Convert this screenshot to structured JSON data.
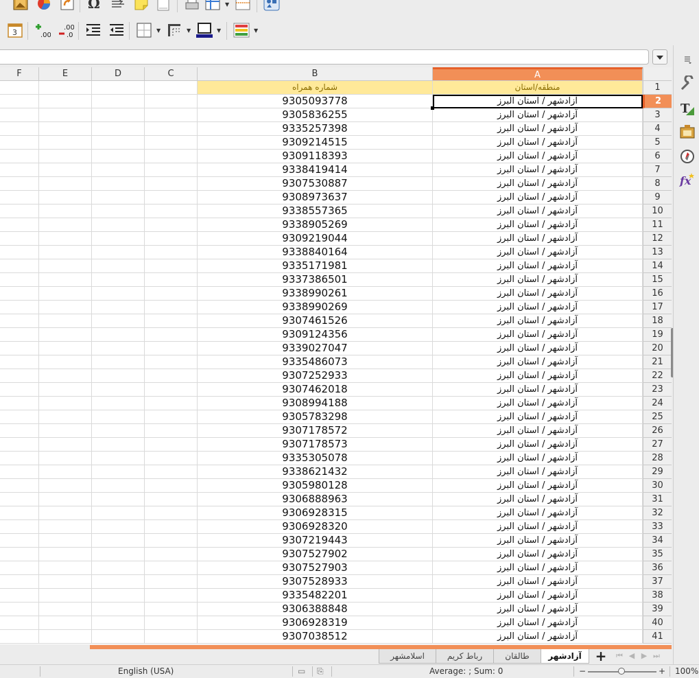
{
  "columns": {
    "f": "F",
    "e": "E",
    "d": "D",
    "c": "C",
    "b": "B",
    "a": "A"
  },
  "header_row": {
    "row": "1",
    "b": "شماره همراه",
    "a": "منطقه/استان"
  },
  "rows": [
    {
      "row": "2",
      "b": "9305093778",
      "a": "آزادشهر / استان البرز"
    },
    {
      "row": "3",
      "b": "9305836255",
      "a": "آزادشهر / استان البرز"
    },
    {
      "row": "4",
      "b": "9335257398",
      "a": "آزادشهر / استان البرز"
    },
    {
      "row": "5",
      "b": "9309214515",
      "a": "آزادشهر / استان البرز"
    },
    {
      "row": "6",
      "b": "9309118393",
      "a": "آزادشهر / استان البرز"
    },
    {
      "row": "7",
      "b": "9338419414",
      "a": "آزادشهر / استان البرز"
    },
    {
      "row": "8",
      "b": "9307530887",
      "a": "آزادشهر / استان البرز"
    },
    {
      "row": "9",
      "b": "9308973637",
      "a": "آزادشهر / استان البرز"
    },
    {
      "row": "10",
      "b": "9338557365",
      "a": "آزادشهر / استان البرز"
    },
    {
      "row": "11",
      "b": "9338905269",
      "a": "آزادشهر / استان البرز"
    },
    {
      "row": "12",
      "b": "9309219044",
      "a": "آزادشهر / استان البرز"
    },
    {
      "row": "13",
      "b": "9338840164",
      "a": "آزادشهر / استان البرز"
    },
    {
      "row": "14",
      "b": "9335171981",
      "a": "آزادشهر / استان البرز"
    },
    {
      "row": "15",
      "b": "9337386501",
      "a": "آزادشهر / استان البرز"
    },
    {
      "row": "16",
      "b": "9338990261",
      "a": "آزادشهر / استان البرز"
    },
    {
      "row": "17",
      "b": "9338990269",
      "a": "آزادشهر / استان البرز"
    },
    {
      "row": "18",
      "b": "9307461526",
      "a": "آزادشهر / استان البرز"
    },
    {
      "row": "19",
      "b": "9309124356",
      "a": "آزادشهر / استان البرز"
    },
    {
      "row": "20",
      "b": "9339027047",
      "a": "آزادشهر / استان البرز"
    },
    {
      "row": "21",
      "b": "9335486073",
      "a": "آزادشهر / استان البرز"
    },
    {
      "row": "22",
      "b": "9307252933",
      "a": "آزادشهر / استان البرز"
    },
    {
      "row": "23",
      "b": "9307462018",
      "a": "آزادشهر / استان البرز"
    },
    {
      "row": "24",
      "b": "9308994188",
      "a": "آزادشهر / استان البرز"
    },
    {
      "row": "25",
      "b": "9305783298",
      "a": "آزادشهر / استان البرز"
    },
    {
      "row": "26",
      "b": "9307178572",
      "a": "آزادشهر / استان البرز"
    },
    {
      "row": "27",
      "b": "9307178573",
      "a": "آزادشهر / استان البرز"
    },
    {
      "row": "28",
      "b": "9335305078",
      "a": "آزادشهر / استان البرز"
    },
    {
      "row": "29",
      "b": "9338621432",
      "a": "آزادشهر / استان البرز"
    },
    {
      "row": "30",
      "b": "9305980128",
      "a": "آزادشهر / استان البرز"
    },
    {
      "row": "31",
      "b": "9306888963",
      "a": "آزادشهر / استان البرز"
    },
    {
      "row": "32",
      "b": "9306928315",
      "a": "آزادشهر / استان البرز"
    },
    {
      "row": "33",
      "b": "9306928320",
      "a": "آزادشهر / استان البرز"
    },
    {
      "row": "34",
      "b": "9307219443",
      "a": "آزادشهر / استان البرز"
    },
    {
      "row": "35",
      "b": "9307527902",
      "a": "آزادشهر / استان البرز"
    },
    {
      "row": "36",
      "b": "9307527903",
      "a": "آزادشهر / استان البرز"
    },
    {
      "row": "37",
      "b": "9307528933",
      "a": "آزادشهر / استان البرز"
    },
    {
      "row": "38",
      "b": "9335482201",
      "a": "آزادشهر / استان البرز"
    },
    {
      "row": "39",
      "b": "9306388848",
      "a": "آزادشهر / استان البرز"
    },
    {
      "row": "40",
      "b": "9306928319",
      "a": "آزادشهر / استان البرز"
    },
    {
      "row": "41",
      "b": "9307038512",
      "a": "آزادشهر / استان البرز"
    }
  ],
  "sheet_tabs": [
    {
      "label": "آزادشهر",
      "active": true
    },
    {
      "label": "طالقان",
      "active": false
    },
    {
      "label": "رباط کریم",
      "active": false
    },
    {
      "label": "اسلامشهر",
      "active": false
    }
  ],
  "status": {
    "language": "English (USA)",
    "summary": "Average: ; Sum: 0",
    "zoom": "100%",
    "zoom_level": 1.0
  },
  "colors": {
    "accent": "#f28f57",
    "header_fill": "#ffe999"
  },
  "toolbar_icons": [
    "image-icon",
    "chart-icon",
    "pivot-table-icon",
    "special-character-icon",
    "hyperlink-icon",
    "comment-icon",
    "header-footer-icon",
    "print-ranges-icon",
    "freeze-rows-columns-icon",
    "split-window-icon",
    "show-draw-functions-icon",
    "number-format-date-icon",
    "add-decimal-icon",
    "delete-decimal-icon",
    "increase-indent-icon",
    "decrease-indent-icon",
    "borders-icon",
    "border-style-icon",
    "border-color-icon",
    "conditional-format-icon"
  ]
}
